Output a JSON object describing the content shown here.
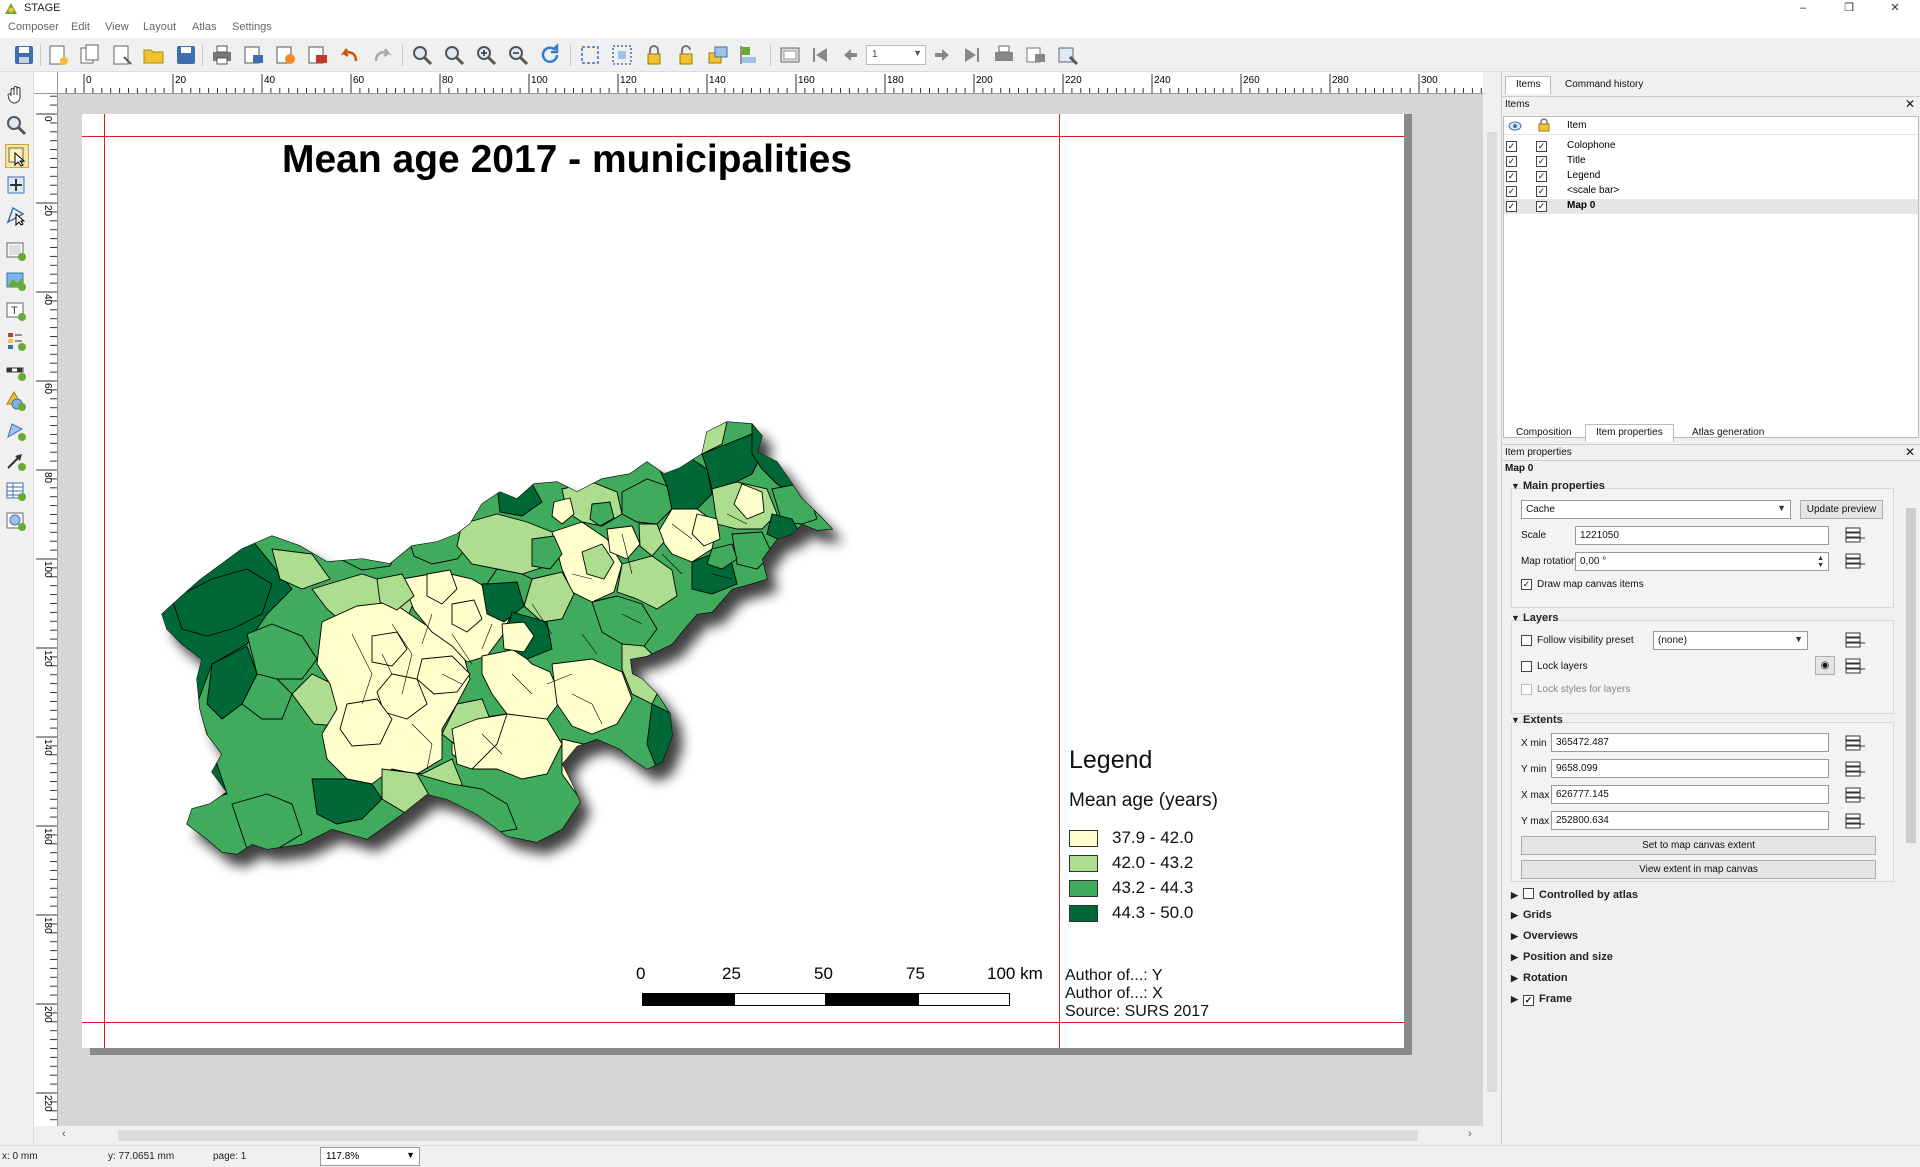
{
  "window": {
    "title": "STAGE",
    "minimize": "–",
    "restore": "❐",
    "close": "✕"
  },
  "menu": [
    "Composer",
    "Edit",
    "View",
    "Layout",
    "Atlas",
    "Settings"
  ],
  "toolbar": {
    "page_number": "1"
  },
  "rulers": {
    "h_labels": [
      "0",
      "20",
      "40",
      "60",
      "80",
      "100",
      "120",
      "140",
      "160",
      "180",
      "200",
      "220",
      "240",
      "260",
      "280",
      "300"
    ],
    "v_labels": [
      "0",
      "20",
      "40",
      "60",
      "80",
      "100",
      "120",
      "140",
      "160",
      "180",
      "200",
      "220"
    ]
  },
  "composition": {
    "title": "Mean age 2017 - municipalities",
    "legend": {
      "title": "Legend",
      "subtitle": "Mean age (years)",
      "classes": [
        {
          "label": "37.9 - 42.0",
          "color": "#ffffcc"
        },
        {
          "label": "42.0 - 43.2",
          "color": "#addd8e"
        },
        {
          "label": "43.2 - 44.3",
          "color": "#41ab5d"
        },
        {
          "label": "44.3 - 50.0",
          "color": "#006837"
        }
      ]
    },
    "scalebar": {
      "labels": [
        "0",
        "25",
        "50",
        "75",
        "100 km"
      ]
    },
    "colophon": [
      "Author of...: Y",
      "Author of...: X",
      "Source: SURS 2017"
    ]
  },
  "status": {
    "x": "x: 0 mm",
    "y": "y: 77.0651 mm",
    "page": "page: 1",
    "zoom": "117.8%"
  },
  "panel": {
    "top_tabs": [
      "Items",
      "Command history"
    ],
    "items_header": "Items",
    "items_col": "Item",
    "items": [
      {
        "name": "Colophone",
        "selected": false
      },
      {
        "name": "Title",
        "selected": false
      },
      {
        "name": "Legend",
        "selected": false
      },
      {
        "name": "<scale bar>",
        "selected": false
      },
      {
        "name": "Map 0",
        "selected": true
      }
    ],
    "bottom_tabs": [
      "Composition",
      "Item properties",
      "Atlas generation"
    ],
    "props_header": "Item properties",
    "item_name": "Map 0",
    "main_properties": {
      "title": "Main properties",
      "cache_mode": "Cache",
      "update_preview": "Update preview",
      "scale_label": "Scale",
      "scale": "1221050",
      "rotation_label": "Map rotation",
      "rotation": "0,00 °",
      "draw_items": "Draw map canvas items"
    },
    "layers": {
      "title": "Layers",
      "follow_preset": "Follow visibility preset",
      "preset": "(none)",
      "lock_layers": "Lock layers",
      "lock_styles": "Lock styles for layers"
    },
    "extents": {
      "title": "Extents",
      "xmin_label": "X min",
      "xmin": "365472.487",
      "ymin_label": "Y min",
      "ymin": "9658.099",
      "xmax_label": "X max",
      "xmax": "626777.145",
      "ymax_label": "Y max",
      "ymax": "252800.634",
      "set_canvas": "Set to map canvas extent",
      "view_extent": "View extent in map canvas"
    },
    "collapsed_groups": [
      "Controlled by atlas",
      "Grids",
      "Overviews",
      "Position and size",
      "Rotation",
      "Frame"
    ]
  }
}
